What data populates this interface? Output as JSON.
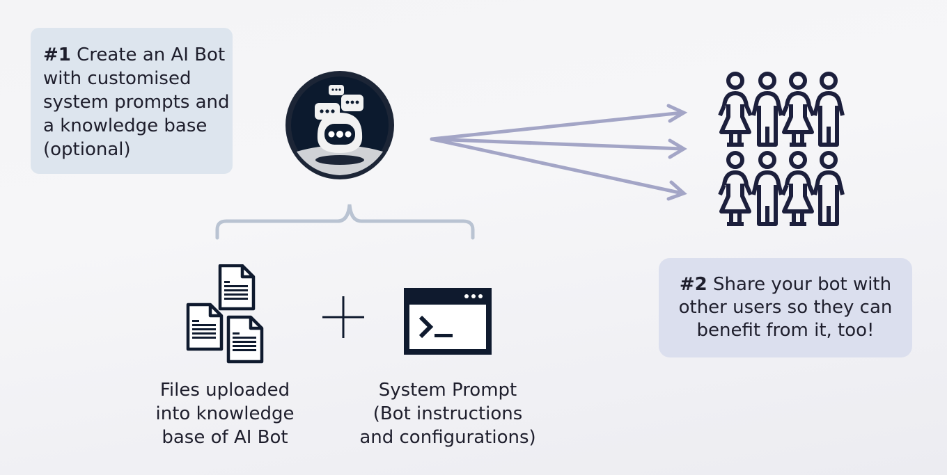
{
  "step1": {
    "number": "#1",
    "text": "Create an AI Bot with customised system prompts and a knowledge base (optional)"
  },
  "step2": {
    "number": "#2",
    "text": "Share your bot with other users so they can benefit from it, too!"
  },
  "files_caption": {
    "line1": "Files uploaded",
    "line2": "into knowledge",
    "line3": "base of AI Bot"
  },
  "prompt_caption": {
    "line1": "System Prompt",
    "line2": "(Bot instructions",
    "line3": "and configurations)"
  },
  "icons": {
    "bot": "ai-bot-icon",
    "users": "user-group-icon",
    "files": "documents-icon",
    "plus": "plus-icon",
    "terminal": "terminal-icon"
  },
  "colors": {
    "dark": "#0f1a2e",
    "arrow": "#a3a5c6",
    "brace": "#b9c3d2",
    "box1_bg": "#dde5ee",
    "box2_bg": "#dbdfee",
    "users": "#1c1f3c"
  }
}
